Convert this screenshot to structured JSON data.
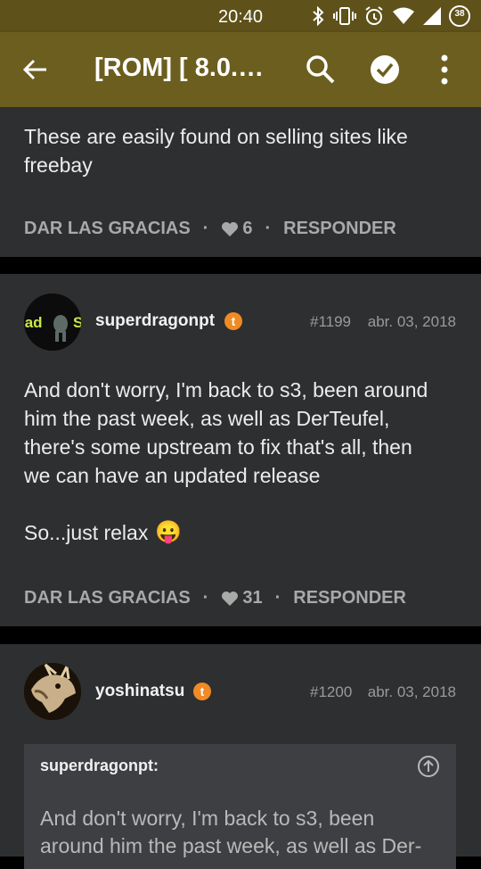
{
  "status_bar": {
    "time": "20:40",
    "battery_level": "38",
    "icons": [
      "bluetooth-icon",
      "vibrate-icon",
      "alarm-icon",
      "wifi-icon",
      "signal-icon",
      "battery-icon"
    ]
  },
  "toolbar": {
    "title": "[ROM] [ 8.0.0...",
    "icons": [
      "back-arrow-icon",
      "search-icon",
      "check-circle-icon",
      "overflow-menu-icon"
    ],
    "background_color": "#6c5e1f"
  },
  "posts": [
    {
      "body_lines": [
        "These are easily found on selling sites like",
        "freebay"
      ],
      "thanks_label": "DAR LAS GRACIAS",
      "likes": "6",
      "reply_label": "RESPONDER"
    },
    {
      "username": "superdragonpt",
      "badge": "t",
      "post_number": "#1199",
      "date": "abr. 03, 2018",
      "body_lines": [
        "And don't worry, I'm back to s3, been around",
        "him the past week, as well as DerTeufel,",
        "there's some upstream to fix that's all, then",
        "we can have an updated release",
        "",
        "So...just relax"
      ],
      "emoji": "😛",
      "thanks_label": "DAR LAS GRACIAS",
      "likes": "31",
      "reply_label": "RESPONDER"
    },
    {
      "username": "yoshinatsu",
      "badge": "t",
      "post_number": "#1200",
      "date": "abr. 03, 2018",
      "quote": {
        "author": "superdragonpt:",
        "lines": [
          "And don't worry, I'm back to s3, been",
          "around him the past week, as well as Der-"
        ]
      }
    }
  ],
  "colors": {
    "status_bar": "#5e511a",
    "card": "#2e2f31",
    "badge": "#f08a24",
    "quote_bg": "#3d3f42"
  }
}
